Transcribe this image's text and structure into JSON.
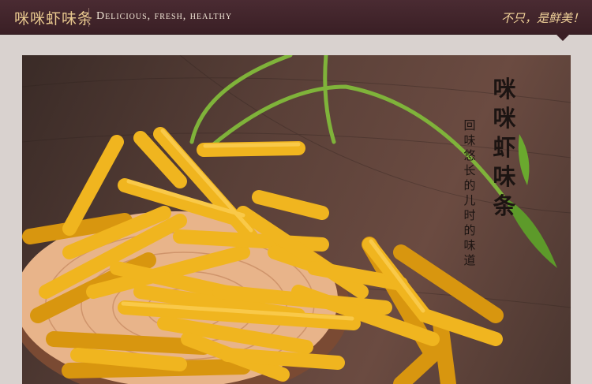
{
  "header": {
    "brand": "咪咪虾味条",
    "tagline": "Delicious, fresh, healthy",
    "slogan": "不只，是鲜美！"
  },
  "photo": {
    "title_chars": [
      "咪",
      "咪",
      "虾",
      "味",
      "条"
    ],
    "subtitle_chars": [
      "回",
      "味",
      "悠",
      "长",
      "的",
      "儿",
      "时",
      "的",
      "味",
      "道"
    ]
  },
  "colors": {
    "header_bg": "#3a1f25",
    "brand_gold": "#e9c98f",
    "page_bg": "#d9d2cf",
    "snack_yellow": "#f0b51f"
  }
}
